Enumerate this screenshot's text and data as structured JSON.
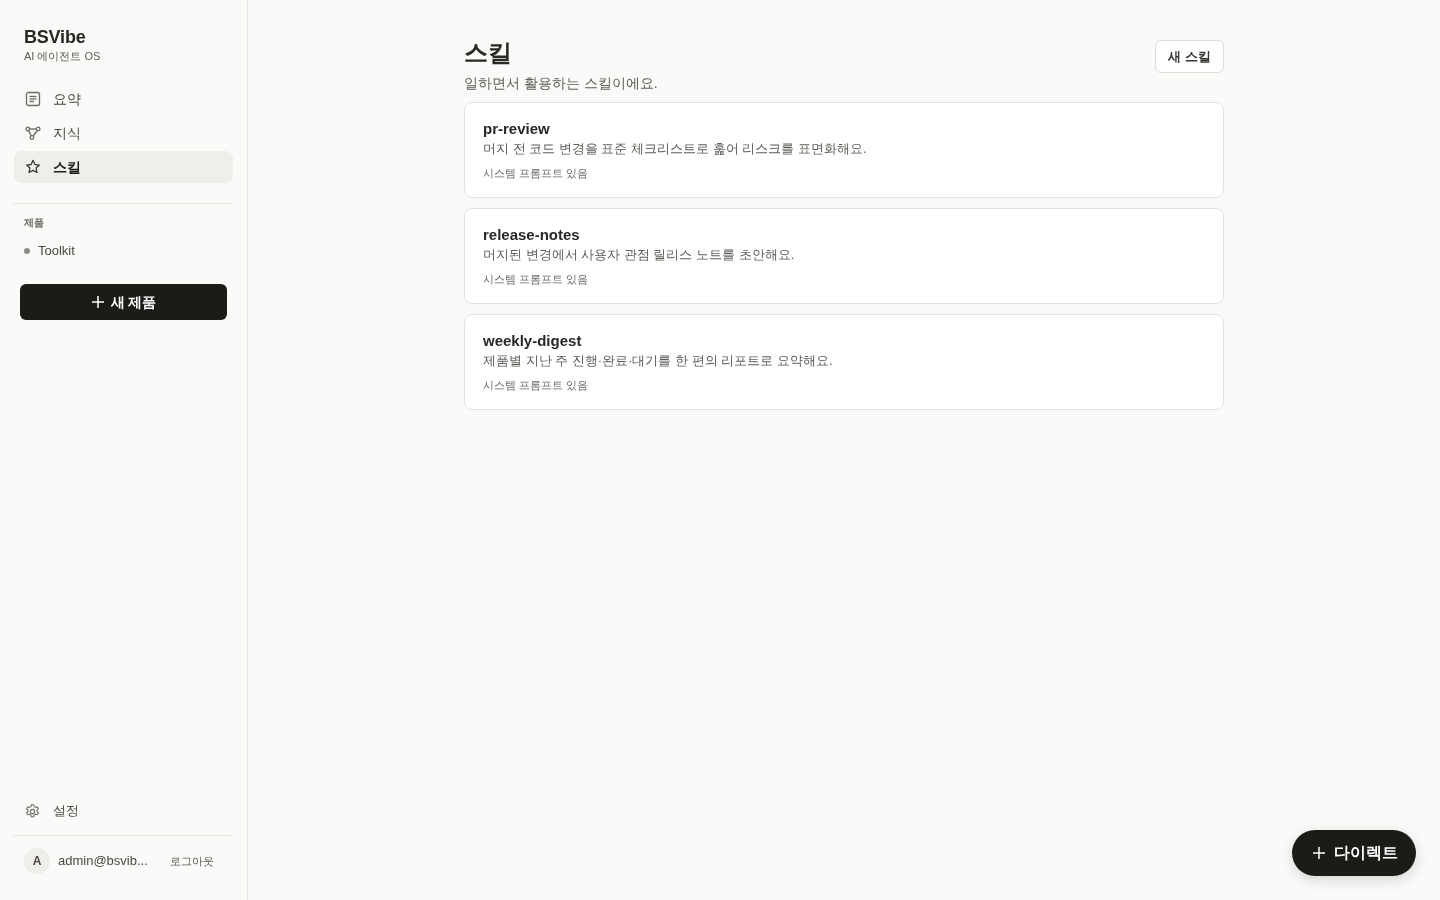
{
  "sidebar": {
    "brand": {
      "name": "BSVibe",
      "tagline": "AI 에이전트 OS"
    },
    "nav": [
      {
        "label": "요약",
        "kind": "document",
        "selected": false
      },
      {
        "label": "지식",
        "kind": "graph",
        "selected": false
      },
      {
        "label": "스킬",
        "kind": "star",
        "selected": true
      }
    ],
    "products": {
      "heading": "제품",
      "items": [
        {
          "label": "Toolkit"
        }
      ]
    },
    "new_product_button": {
      "label": "새 제품"
    },
    "settings": {
      "label": "설정"
    },
    "user": {
      "avatar": "A",
      "email": "admin@bsvib...",
      "logout": "로그아웃"
    }
  },
  "page": {
    "title": "스킬",
    "subtitle": "일하면서 활용하는 스킬이에요.",
    "new_button": "새 스킬"
  },
  "skills": [
    {
      "name": "pr-review",
      "description": "머지 전 코드 변경을 표준 체크리스트로 훑어 리스크를 표면화해요.",
      "meta": "시스템 프롬프트 있음"
    },
    {
      "name": "release-notes",
      "description": "머지된 변경에서 사용자 관점 릴리스 노트를 초안해요.",
      "meta": "시스템 프롬프트 있음"
    },
    {
      "name": "weekly-digest",
      "description": "제품별 지난 주 진행·완료·대기를 한 편의 리포트로 요약해요.",
      "meta": "시스템 프롬프트 있음"
    }
  ],
  "fab": {
    "label": "다이렉트"
  }
}
